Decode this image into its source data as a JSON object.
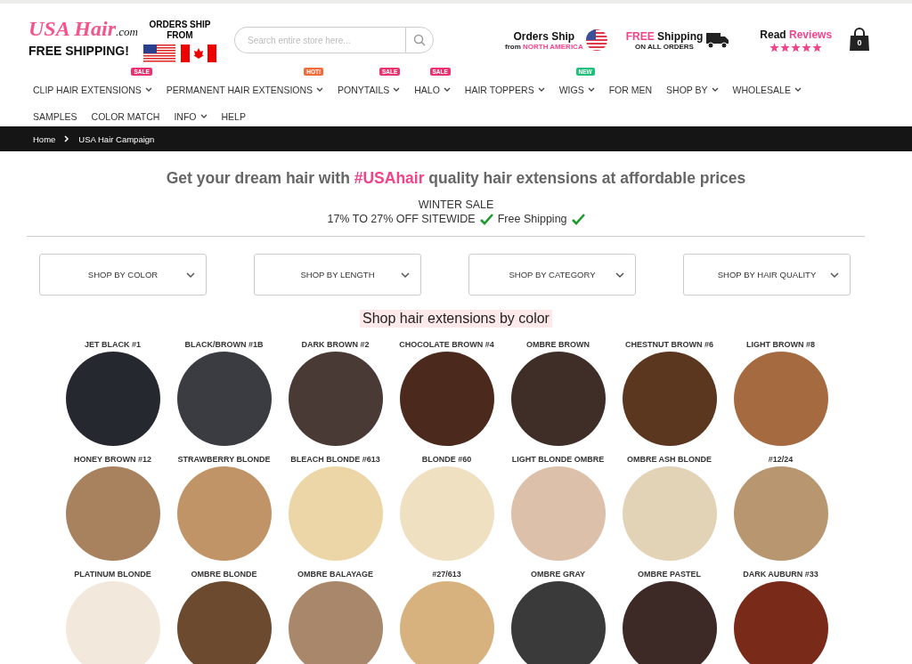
{
  "header": {
    "logo": {
      "brand": "USA Hair",
      "suffix": ".com",
      "tagline": "FREE SHIPPING!",
      "ships_from": "ORDERS SHIP FROM"
    },
    "search": {
      "placeholder": "Search entire store here..."
    },
    "promos": [
      {
        "kind": "ship",
        "title": "Orders Ship",
        "line_1": "from",
        "line_2": "NORTH AMERICA"
      },
      {
        "kind": "free",
        "title_accent": "FREE",
        "title": "Shipping",
        "line_1": "ON ALL ORDERS"
      },
      {
        "kind": "reviews",
        "title": "Read",
        "title_accent": "Reviews",
        "stars": 5
      }
    ],
    "cart": {
      "count": "0"
    }
  },
  "nav": [
    {
      "label": "CLIP HAIR EXTENSIONS",
      "dropdown": true,
      "badge": {
        "text": "SALE",
        "color": "#e8336f"
      }
    },
    {
      "label": "PERMANENT HAIR EXTENSIONS",
      "dropdown": true,
      "badge": {
        "text": "HOT!",
        "color": "#f26b3a"
      }
    },
    {
      "label": "PONYTAILS",
      "dropdown": true,
      "badge": {
        "text": "SALE",
        "color": "#e8336f"
      }
    },
    {
      "label": "HALO",
      "dropdown": true,
      "badge": {
        "text": "SALE",
        "color": "#e8336f"
      }
    },
    {
      "label": "HAIR TOPPERS",
      "dropdown": true
    },
    {
      "label": "WIGS",
      "dropdown": true,
      "badge": {
        "text": "NEW",
        "color": "#21c07a"
      }
    },
    {
      "label": "FOR MEN",
      "dropdown": false
    },
    {
      "label": "SHOP BY",
      "dropdown": true
    },
    {
      "label": "WHOLESALE",
      "dropdown": true
    },
    {
      "label": "SAMPLES",
      "dropdown": false
    },
    {
      "label": "COLOR MATCH",
      "dropdown": false
    },
    {
      "label": "INFO",
      "dropdown": true
    },
    {
      "label": "HELP",
      "dropdown": false
    }
  ],
  "breadcrumb": [
    "Home",
    "USA Hair Campaign"
  ],
  "hero": {
    "headline": "Get your dream hair with **#USAhair** quality hair extensions at affordable prices",
    "sale_title": "WINTER SALE",
    "sale_offer": "17% TO 27% OFF SITEWIDE",
    "sale_extra": "Free Shipping"
  },
  "filters": [
    "SHOP BY COLOR",
    "SHOP BY LENGTH",
    "SHOP BY CATEGORY",
    "SHOP BY HAIR QUALITY"
  ],
  "section_title": "Shop hair extensions by color",
  "swatches": [
    {
      "name": "JET BLACK #1",
      "color": "#25282f"
    },
    {
      "name": "BLACK/BROWN #1B",
      "color": "#3b3c42"
    },
    {
      "name": "DARK BROWN #2",
      "color": "#4a3a36"
    },
    {
      "name": "CHOCOLATE BROWN #4",
      "color": "#4b2a1d"
    },
    {
      "name": "OMBRE BROWN",
      "color": "#3f2e28"
    },
    {
      "name": "CHESTNUT BROWN #6",
      "color": "#5c3720"
    },
    {
      "name": "LIGHT BROWN #8",
      "color": "#a56a40"
    },
    {
      "name": "HONEY BROWN #12",
      "color": "#a8815f"
    },
    {
      "name": "STRAWBERRY BLONDE",
      "color": "#c09466"
    },
    {
      "name": "BLEACH BLONDE #613",
      "color": "#ecd6a8"
    },
    {
      "name": "BLONDE #60",
      "color": "#f0e0c2"
    },
    {
      "name": "LIGHT BLONDE OMBRE",
      "color": "#dcc0aa"
    },
    {
      "name": "OMBRE ASH BLONDE",
      "color": "#e2d2b6"
    },
    {
      "name": "#12/24",
      "color": "#b89670"
    },
    {
      "name": "PLATINUM BLONDE",
      "color": "#f2e9dc"
    },
    {
      "name": "OMBRE BLONDE",
      "color": "#6b4a30"
    },
    {
      "name": "OMBRE BALAYAGE",
      "color": "#a9876a"
    },
    {
      "name": "#27/613",
      "color": "#d8b27e"
    },
    {
      "name": "OMBRE GRAY",
      "color": "#3a3a3a"
    },
    {
      "name": "OMBRE PASTEL",
      "color": "#3d2a26"
    },
    {
      "name": "DARK AUBURN #33",
      "color": "#7a2a18"
    }
  ]
}
